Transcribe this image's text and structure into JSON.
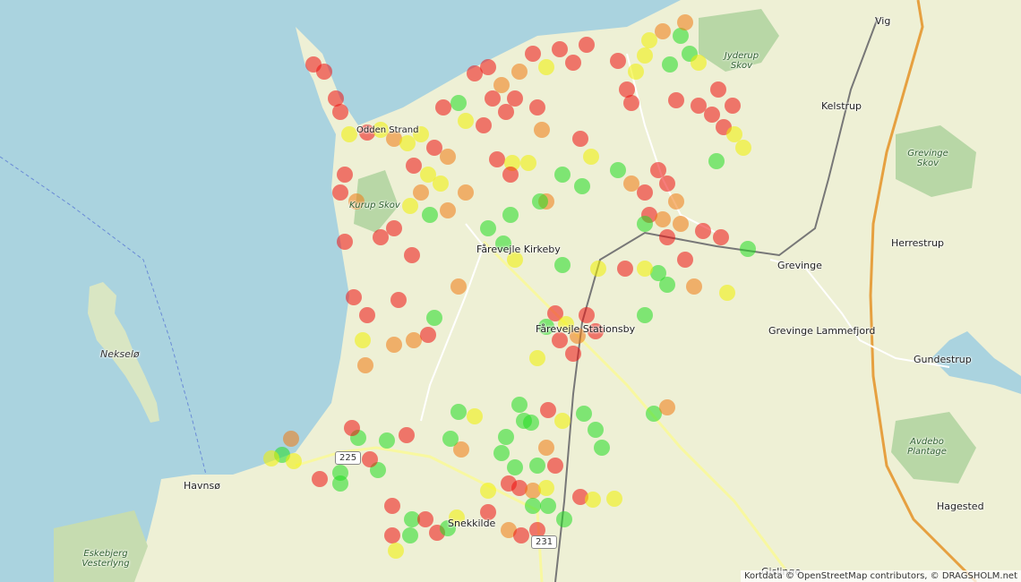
{
  "map": {
    "attribution": "Kortdata © OpenStreetMap contributors, © DRAGSHOLM.net",
    "colors": {
      "water": "#aad3df",
      "land": "#eef0d5",
      "forest": "#add19e",
      "marker_green": "#22dd22",
      "marker_yellow": "#f0f000",
      "marker_orange": "#f07a10",
      "marker_red": "#ee1111"
    },
    "places": {
      "vig": "Vig",
      "kelstrup": "Kelstrup",
      "herrestrup": "Herrestrup",
      "grevinge": "Grevinge",
      "grevinge_lammefjord": "Grevinge Lammefjord",
      "gundestrup": "Gundestrup",
      "hagested": "Hagested",
      "gislinge": "Gislinge",
      "havnso": "Havnsø",
      "nekselo": "Nekselø",
      "farevejle_kirkeby": "Fårevejle Kirkeby",
      "farevejle_stationsby": "Fårevejle Stationsby",
      "odden_strand": "Odden Strand",
      "jydeup_skov": "Jyderup Skov",
      "grevinge_skov": "Grevinge Skov",
      "kurup_skov": "Kurup Skov",
      "avdebo_plantage": "Avdebo Plantage",
      "eskebjerg": "Eskebjerg Vesterlyng",
      "snekkilde": "Snekkilde"
    },
    "road_shields": {
      "r225": "225",
      "r231": "231"
    },
    "marker_levels": [
      "green",
      "yellow",
      "orange",
      "red"
    ]
  }
}
